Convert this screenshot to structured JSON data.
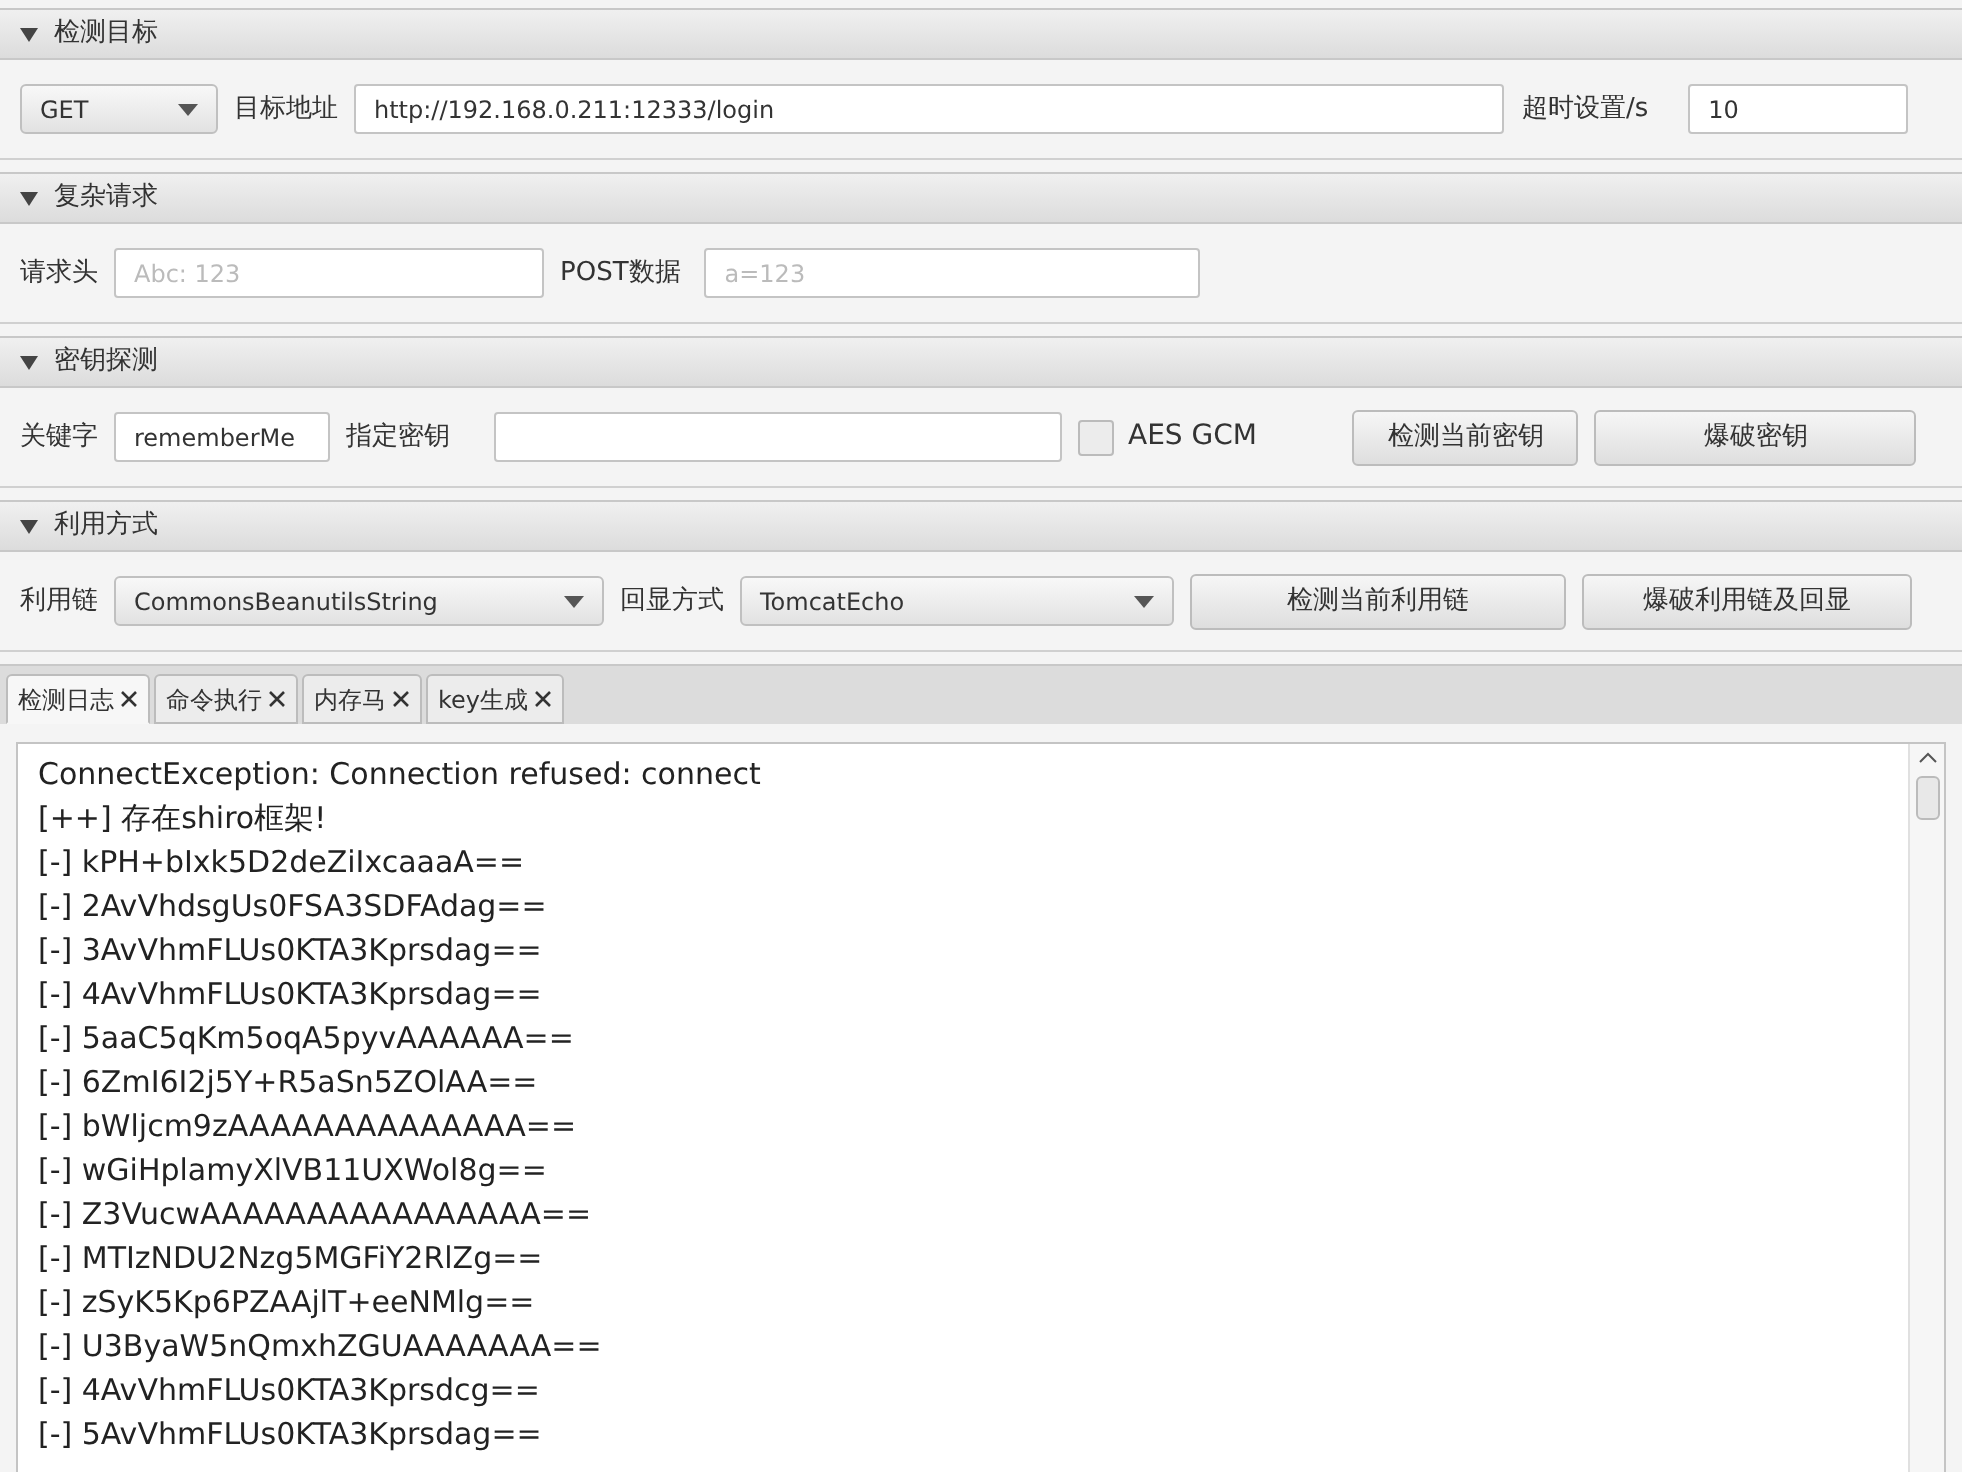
{
  "sections": [
    {
      "title": "检测目标",
      "expanded": true,
      "controls": [
        {
          "kind": "select",
          "value": "GET"
        },
        {
          "kind": "label",
          "text": "目标地址"
        },
        {
          "kind": "input",
          "value": "http://192.168.0.211:12333/login"
        },
        {
          "kind": "label",
          "text": "超时设置/s"
        },
        {
          "kind": "input",
          "value": "10"
        }
      ]
    },
    {
      "title": "复杂请求",
      "expanded": true,
      "controls": [
        {
          "kind": "label",
          "text": "请求头"
        },
        {
          "kind": "input",
          "placeholder": "Abc: 123"
        },
        {
          "kind": "label",
          "text": "POST数据"
        },
        {
          "kind": "input",
          "placeholder": "a=123"
        }
      ]
    },
    {
      "title": "密钥探测",
      "expanded": true,
      "controls": [
        {
          "kind": "label",
          "text": "关键字"
        },
        {
          "kind": "input",
          "value": "rememberMe"
        },
        {
          "kind": "label",
          "text": "指定密钥"
        },
        {
          "kind": "input"
        },
        {
          "kind": "checkbox",
          "text": "AES GCM",
          "checked": false
        },
        {
          "kind": "button",
          "text": "检测当前密钥"
        },
        {
          "kind": "button",
          "text": "爆破密钥"
        }
      ]
    },
    {
      "title": "利用方式",
      "expanded": true,
      "controls": [
        {
          "kind": "label",
          "text": "利用链"
        },
        {
          "kind": "select",
          "value": "CommonsBeanutilsString"
        },
        {
          "kind": "label",
          "text": "回显方式"
        },
        {
          "kind": "select",
          "value": "TomcatEcho"
        },
        {
          "kind": "button",
          "text": "检测当前利用链"
        },
        {
          "kind": "button",
          "text": "爆破利用链及回显"
        }
      ]
    }
  ],
  "tabs": [
    {
      "label": "检测日志",
      "selected": true
    },
    {
      "label": "命令执行",
      "selected": false
    },
    {
      "label": "内存马",
      "selected": false
    },
    {
      "label": "key生成",
      "selected": false
    }
  ],
  "log": [
    "ConnectException: Connection refused: connect",
    "[++] 存在shiro框架!",
    "[-] kPH+bIxk5D2deZiIxcaaaA==",
    "[-] 2AvVhdsgUs0FSA3SDFAdag==",
    "[-] 3AvVhmFLUs0KTA3Kprsdag==",
    "[-] 4AvVhmFLUs0KTA3Kprsdag==",
    "[-] 5aaC5qKm5oqA5pyvAAAAAA==",
    "[-] 6ZmI6I2j5Y+R5aSn5ZOlAA==",
    "[-] bWljcm9zAAAAAAAAAAAAAA==",
    "[-] wGiHplamyXlVB11UXWol8g==",
    "[-] Z3VucwAAAAAAAAAAAAAAAA==",
    "[-] MTIzNDU2Nzg5MGFiY2RlZg==",
    "[-] zSyK5Kp6PZAAjlT+eeNMlg==",
    "[-] U3ByaW5nQmxhZGUAAAAAAA==",
    "[-] 4AvVhmFLUs0KTA3Kprsdcg==",
    "[-] 5AvVhmFLUs0KTA3Kprsdag=="
  ]
}
